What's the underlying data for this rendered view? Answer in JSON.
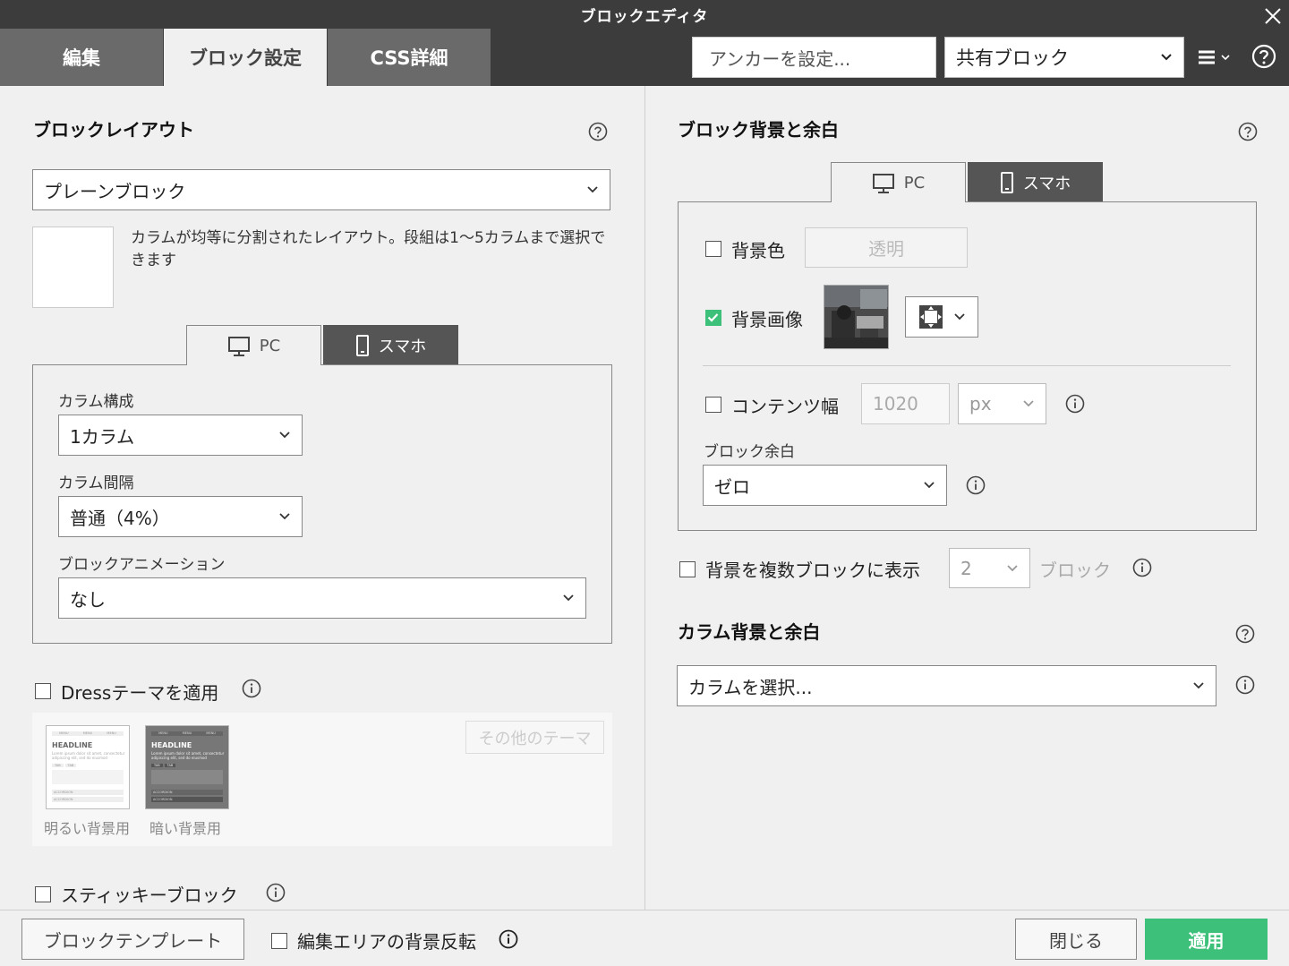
{
  "window": {
    "title": "ブロックエディタ"
  },
  "top_tabs": [
    {
      "label": "編集"
    },
    {
      "label": "ブロック設定"
    },
    {
      "label": "CSS詳細"
    }
  ],
  "anchor": {
    "placeholder": "アンカーを設定..."
  },
  "shared_block": {
    "value": "共有ブロック"
  },
  "left": {
    "layout_title": "ブロックレイアウト",
    "layout_select": "プレーンブロック",
    "layout_desc": "カラムが均等に分割されたレイアウト。段組は1〜5カラムまで選択できます",
    "device_tabs": [
      {
        "label": "PC"
      },
      {
        "label": "スマホ"
      }
    ],
    "column_config_label": "カラム構成",
    "column_config_value": "1カラム",
    "column_gap_label": "カラム間隔",
    "column_gap_value": "普通（4%）",
    "animation_label": "ブロックアニメーション",
    "animation_value": "なし",
    "dress_theme_label": "Dressテーマを適用",
    "themes": [
      {
        "caption": "明るい背景用",
        "menu": [
          "MENU",
          "MENU",
          "MENU"
        ],
        "headline": "HEADLINE",
        "body": "Lorem ipsum dolor sit amet, consectetur adipiscing elit, sed do eiusmod",
        "tabs": [
          "TAB",
          "TAB"
        ],
        "accordion": [
          "ACCORDION",
          "ACCORDION"
        ]
      },
      {
        "caption": "暗い背景用",
        "menu": [
          "MENU",
          "MENU",
          "MENU"
        ],
        "headline": "HEADLINE",
        "body": "Lorem ipsum dolor sit amet, consectetur adipiscing elit, sed do eiusmod",
        "tabs": [
          "TAB",
          "TAB"
        ],
        "accordion": [
          "ACCORDION",
          "ACCORDION"
        ]
      }
    ],
    "other_themes_label": "その他のテーマ",
    "sticky_label": "スティッキーブロック"
  },
  "right": {
    "bg_title": "ブロック背景と余白",
    "device_tabs": [
      {
        "label": "PC"
      },
      {
        "label": "スマホ"
      }
    ],
    "bg_color_label": "背景色",
    "bg_color_value": "透明",
    "bg_color_checked": false,
    "bg_image_label": "背景画像",
    "bg_image_checked": true,
    "content_width_label": "コンテンツ幅",
    "content_width_value": "1020",
    "content_width_unit": "px",
    "block_margin_label": "ブロック余白",
    "block_margin_value": "ゼロ",
    "multi_bg_label": "背景を複数ブロックに表示",
    "multi_bg_count": "2",
    "multi_bg_suffix": "ブロック",
    "column_bg_title": "カラム背景と余白",
    "column_select_placeholder": "カラムを選択..."
  },
  "footer": {
    "template_button": "ブロックテンプレート",
    "invert_bg_label": "編集エリアの背景反転",
    "close_button": "閉じる",
    "apply_button": "適用"
  },
  "colors": {
    "accent": "#3cc07a",
    "titlebar": "#3c3c3c",
    "tab_inactive": "#6a6a6a"
  }
}
